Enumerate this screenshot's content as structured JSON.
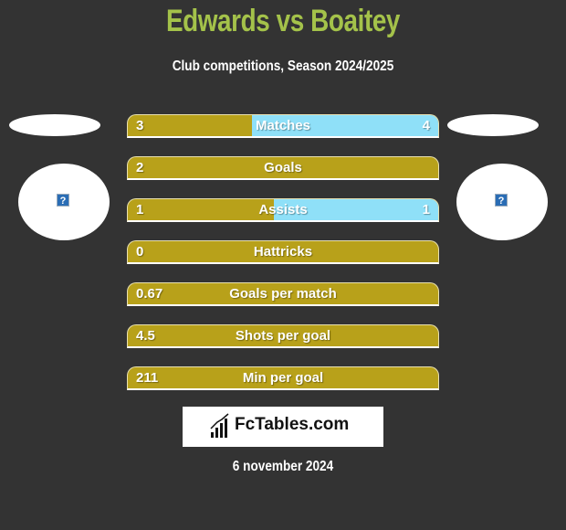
{
  "header": {
    "title": "Edwards vs Boaitey",
    "subtitle": "Club competitions, Season 2024/2025"
  },
  "players": {
    "left": {
      "name": "Edwards",
      "avatar_icon": "missing-image-icon"
    },
    "right": {
      "name": "Boaitey",
      "avatar_icon": "missing-image-icon"
    }
  },
  "colors": {
    "background": "#333333",
    "title": "#a4c24a",
    "left_bar": "#b8a11a",
    "right_bar": "#8fe0f8"
  },
  "stats": [
    {
      "label": "Matches",
      "left": "3",
      "right": "4",
      "left_share": 0.4
    },
    {
      "label": "Goals",
      "left": "2",
      "right": "",
      "left_share": 1.0
    },
    {
      "label": "Assists",
      "left": "1",
      "right": "1",
      "left_share": 0.47
    },
    {
      "label": "Hattricks",
      "left": "0",
      "right": "",
      "left_share": 1.0
    },
    {
      "label": "Goals per match",
      "left": "0.67",
      "right": "",
      "left_share": 1.0
    },
    {
      "label": "Shots per goal",
      "left": "4.5",
      "right": "",
      "left_share": 1.0
    },
    {
      "label": "Min per goal",
      "left": "211",
      "right": "",
      "left_share": 1.0
    }
  ],
  "footer": {
    "logo_text": "FcTables.com",
    "date": "6 november 2024"
  }
}
